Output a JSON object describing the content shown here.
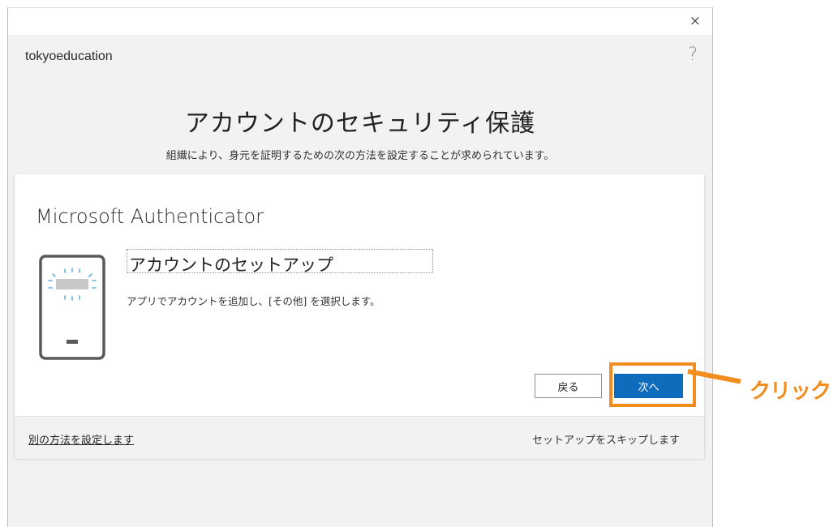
{
  "window": {
    "close_glyph": "×",
    "tenant_name": "tokyoeducation",
    "help_glyph": "?"
  },
  "page": {
    "title": "アカウントのセキュリティ保護",
    "subtitle": "組織により、身元を証明するための次の方法を設定することが求められています。"
  },
  "card": {
    "method_title": "Microsoft Authenticator",
    "icon": "phone-icon",
    "step_title": "アカウントのセットアップ",
    "step_description": "アプリでアカウントを追加し、[その他] を選択します。",
    "back_button": "戻る",
    "next_button": "次へ",
    "alt_method_link": "別の方法を設定します",
    "skip_link": "セットアップをスキップします"
  },
  "annotation": {
    "label": "クリック",
    "color": "#f08d1e"
  },
  "colors": {
    "primary": "#0f6cbd",
    "header_bg": "#f2f2f2"
  }
}
